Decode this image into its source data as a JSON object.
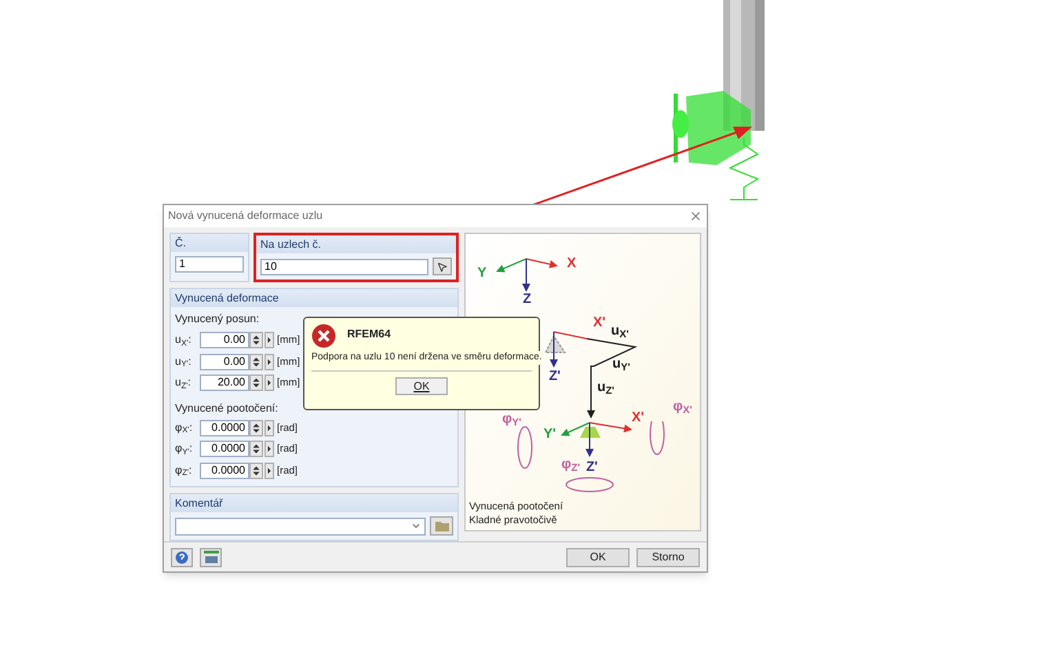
{
  "dialog": {
    "title": "Nová vynucená deformace uzlu"
  },
  "number_group": {
    "label": "Č.",
    "value": "1"
  },
  "nodes_group": {
    "label": "Na uzlech č.",
    "value": "10"
  },
  "deformation_group": {
    "label": "Vynucená deformace",
    "displacement_label": "Vynucený posun:",
    "displacements": [
      {
        "label": "u$_{X'}$:",
        "value": "0.00",
        "unit": "[mm]"
      },
      {
        "label": "u$_{Y'}$:",
        "value": "0.00",
        "unit": "[mm]"
      },
      {
        "label": "u$_{Z'}$:",
        "value": "20.00",
        "unit": "[mm]"
      }
    ],
    "rotation_label": "Vynucené pootočení:",
    "rotations": [
      {
        "label": "φ$_{X'}$:",
        "value": "0.0000",
        "unit": "[rad]"
      },
      {
        "label": "φ$_{Y'}$:",
        "value": "0.0000",
        "unit": "[rad]"
      },
      {
        "label": "φ$_{Z'}$:",
        "value": "0.0000",
        "unit": "[rad]"
      }
    ]
  },
  "comment_group": {
    "label": "Komentář"
  },
  "diagram": {
    "labels": [
      {
        "text": "X",
        "color": "#e03030"
      },
      {
        "text": "Y",
        "color": "#20a040"
      },
      {
        "text": "Z",
        "color": "#303090"
      },
      {
        "text": "X'",
        "color": "#e03030"
      },
      {
        "text": "u$_{X'}$",
        "color": "#202020"
      },
      {
        "text": "u$_{Y'}$",
        "color": "#202020"
      },
      {
        "text": "u$_{Z'}$",
        "color": "#202020"
      },
      {
        "text": "Z'",
        "color": "#303090"
      },
      {
        "text": "X'",
        "color": "#e03030"
      },
      {
        "text": "Y'",
        "color": "#20a040"
      },
      {
        "text": "Z'",
        "color": "#303090"
      },
      {
        "text": "φ$_{Y'}$",
        "color": "#c060a0"
      },
      {
        "text": "φ$_{X'}$",
        "color": "#c060a0"
      },
      {
        "text": "φ$_{Z'}$",
        "color": "#c060a0"
      }
    ],
    "caption": [
      "Vynucená pootočení",
      "Kladné pravotočivě"
    ]
  },
  "buttons": [
    "OK",
    "Storno"
  ],
  "error_popup": {
    "title": "RFEM64",
    "message": "Podpora na uzlu 10 není držena ve směru deformace.",
    "button": "OK"
  }
}
